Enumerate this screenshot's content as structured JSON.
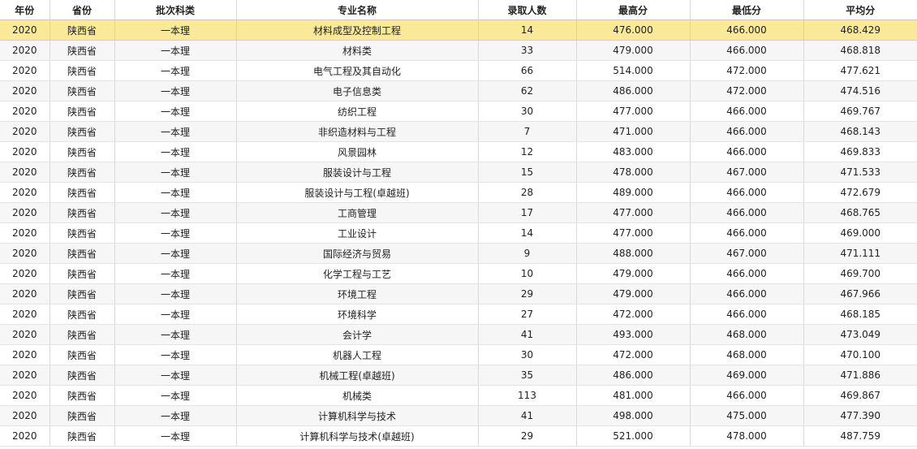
{
  "columns": [
    "年份",
    "省份",
    "批次科类",
    "专业名称",
    "录取人数",
    "最高分",
    "最低分",
    "平均分"
  ],
  "selected_row": 0,
  "colors": {
    "selected_row": "#fbe99a",
    "alt_row": "#f6f6f6",
    "grid_line": "#d9d9d9"
  },
  "rows": [
    [
      "2020",
      "陕西省",
      "一本理",
      "材料成型及控制工程",
      "14",
      "476.000",
      "466.000",
      "468.429"
    ],
    [
      "2020",
      "陕西省",
      "一本理",
      "材料类",
      "33",
      "479.000",
      "466.000",
      "468.818"
    ],
    [
      "2020",
      "陕西省",
      "一本理",
      "电气工程及其自动化",
      "66",
      "514.000",
      "472.000",
      "477.621"
    ],
    [
      "2020",
      "陕西省",
      "一本理",
      "电子信息类",
      "62",
      "486.000",
      "472.000",
      "474.516"
    ],
    [
      "2020",
      "陕西省",
      "一本理",
      "纺织工程",
      "30",
      "477.000",
      "466.000",
      "469.767"
    ],
    [
      "2020",
      "陕西省",
      "一本理",
      "非织造材料与工程",
      "7",
      "471.000",
      "466.000",
      "468.143"
    ],
    [
      "2020",
      "陕西省",
      "一本理",
      "风景园林",
      "12",
      "483.000",
      "466.000",
      "469.833"
    ],
    [
      "2020",
      "陕西省",
      "一本理",
      "服装设计与工程",
      "15",
      "478.000",
      "467.000",
      "471.533"
    ],
    [
      "2020",
      "陕西省",
      "一本理",
      "服装设计与工程(卓越班)",
      "28",
      "489.000",
      "466.000",
      "472.679"
    ],
    [
      "2020",
      "陕西省",
      "一本理",
      "工商管理",
      "17",
      "477.000",
      "466.000",
      "468.765"
    ],
    [
      "2020",
      "陕西省",
      "一本理",
      "工业设计",
      "14",
      "477.000",
      "466.000",
      "469.000"
    ],
    [
      "2020",
      "陕西省",
      "一本理",
      "国际经济与贸易",
      "9",
      "488.000",
      "467.000",
      "471.111"
    ],
    [
      "2020",
      "陕西省",
      "一本理",
      "化学工程与工艺",
      "10",
      "479.000",
      "466.000",
      "469.700"
    ],
    [
      "2020",
      "陕西省",
      "一本理",
      "环境工程",
      "29",
      "479.000",
      "466.000",
      "467.966"
    ],
    [
      "2020",
      "陕西省",
      "一本理",
      "环境科学",
      "27",
      "472.000",
      "466.000",
      "468.185"
    ],
    [
      "2020",
      "陕西省",
      "一本理",
      "会计学",
      "41",
      "493.000",
      "468.000",
      "473.049"
    ],
    [
      "2020",
      "陕西省",
      "一本理",
      "机器人工程",
      "30",
      "472.000",
      "468.000",
      "470.100"
    ],
    [
      "2020",
      "陕西省",
      "一本理",
      "机械工程(卓越班)",
      "35",
      "486.000",
      "469.000",
      "471.886"
    ],
    [
      "2020",
      "陕西省",
      "一本理",
      "机械类",
      "113",
      "481.000",
      "466.000",
      "469.867"
    ],
    [
      "2020",
      "陕西省",
      "一本理",
      "计算机科学与技术",
      "41",
      "498.000",
      "475.000",
      "477.390"
    ],
    [
      "2020",
      "陕西省",
      "一本理",
      "计算机科学与技术(卓越班)",
      "29",
      "521.000",
      "478.000",
      "487.759"
    ]
  ]
}
